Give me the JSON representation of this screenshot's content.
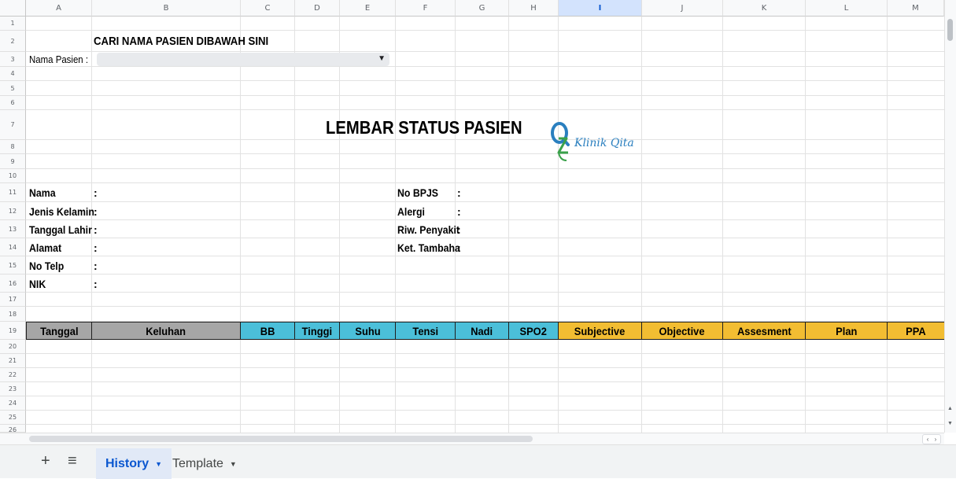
{
  "columns": [
    "A",
    "B",
    "C",
    "D",
    "E",
    "F",
    "G",
    "H",
    "I",
    "J",
    "K",
    "L",
    "M"
  ],
  "rows": [
    "1",
    "2",
    "3",
    "4",
    "5",
    "6",
    "7",
    "8",
    "9",
    "10",
    "11",
    "12",
    "13",
    "14",
    "15",
    "16",
    "17",
    "18",
    "19",
    "20",
    "21",
    "22",
    "23",
    "24",
    "25",
    "26"
  ],
  "search": {
    "heading": "CARI NAMA PASIEN DIBAWAH SINI",
    "label": "Nama Pasien :",
    "arrow": "▼"
  },
  "title": "LEMBAR STATUS PASIEN",
  "logo_text": "Klinik Qita",
  "fields_left": [
    {
      "label": "Nama",
      "colon": ":"
    },
    {
      "label": "Jenis Kelamin",
      "colon": ":"
    },
    {
      "label": "Tanggal Lahir",
      "colon": ":"
    },
    {
      "label": "Alamat",
      "colon": ":"
    },
    {
      "label": "No Telp",
      "colon": ":"
    },
    {
      "label": "NIK",
      "colon": ":"
    }
  ],
  "fields_right": [
    {
      "label": "No BPJS",
      "colon": ":"
    },
    {
      "label": "Alergi",
      "colon": ":"
    },
    {
      "label": "Riw. Penyakit",
      "colon": ":"
    },
    {
      "label": "Ket. Tambaha",
      "colon": ":"
    }
  ],
  "table_headers": [
    "Tanggal",
    "Keluhan",
    "BB",
    "Tinggi",
    "Suhu",
    "Tensi",
    "Nadi",
    "SPO2",
    "Subjective",
    "Objective",
    "Assesment",
    "Plan",
    "PPA"
  ],
  "colors": {
    "gray": "#a6a6a6",
    "cyan": "#4bbfd9",
    "yellow": "#f2bd32",
    "accent": "#0b57d0"
  },
  "tabs": [
    {
      "label": "History",
      "active": true
    },
    {
      "label": "Template",
      "active": false
    }
  ],
  "toolbar": {
    "add": "+",
    "menu": "≡",
    "caret": "▼"
  },
  "scroll": {
    "up": "▲",
    "down": "▼",
    "left": "‹",
    "right": "›"
  }
}
